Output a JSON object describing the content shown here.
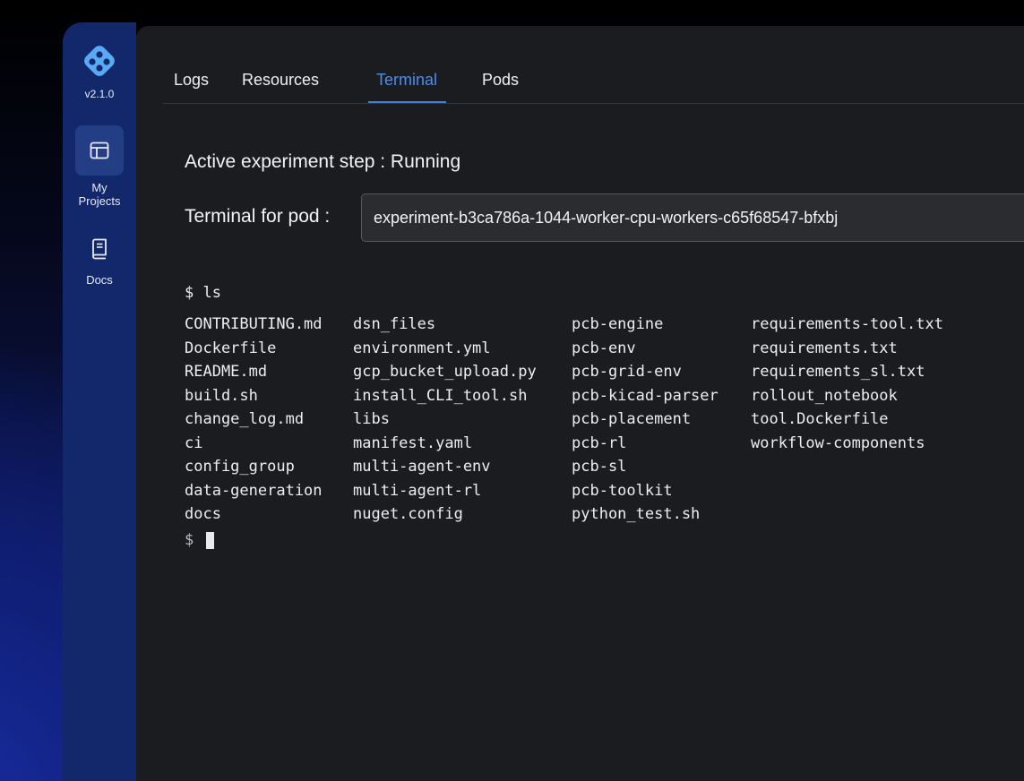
{
  "sidebar": {
    "version": "v2.1.0",
    "items": [
      {
        "label": "My\nProjects",
        "icon": "layout-icon",
        "active": true
      },
      {
        "label": "Docs",
        "icon": "book-icon",
        "active": false
      }
    ]
  },
  "tabs": [
    {
      "label": "Logs"
    },
    {
      "label": "Resources"
    },
    {
      "label": "Terminal",
      "active": true
    },
    {
      "label": "Pods"
    }
  ],
  "experiment": {
    "status_text": "Active experiment step : Running",
    "pod_label": "Terminal for pod :",
    "pod_value": "experiment-b3ca786a-1044-worker-cpu-workers-c65f68547-bfxbj"
  },
  "terminal": {
    "command": "$ ls",
    "prompt": "$",
    "columns": [
      [
        "CONTRIBUTING.md",
        "Dockerfile",
        "README.md",
        "build.sh",
        "change_log.md",
        "ci",
        "config_group",
        "data-generation",
        "docs"
      ],
      [
        "dsn_files",
        "environment.yml",
        "gcp_bucket_upload.py",
        "install_CLI_tool.sh",
        "libs",
        "manifest.yaml",
        "multi-agent-env",
        "multi-agent-rl",
        "nuget.config"
      ],
      [
        "pcb-engine",
        "pcb-env",
        "pcb-grid-env",
        "pcb-kicad-parser",
        "pcb-placement",
        "pcb-rl",
        "pcb-sl",
        "pcb-toolkit",
        "python_test.sh"
      ],
      [
        "requirements-tool.txt",
        "requirements.txt",
        "requirements_sl.txt",
        "rollout_notebook",
        "tool.Dockerfile",
        "workflow-components"
      ]
    ]
  },
  "colors": {
    "accent": "#4a8ef0",
    "sidebar": "#12286a",
    "panel": "#1a1c1f",
    "logo": "#5aa9f5"
  }
}
